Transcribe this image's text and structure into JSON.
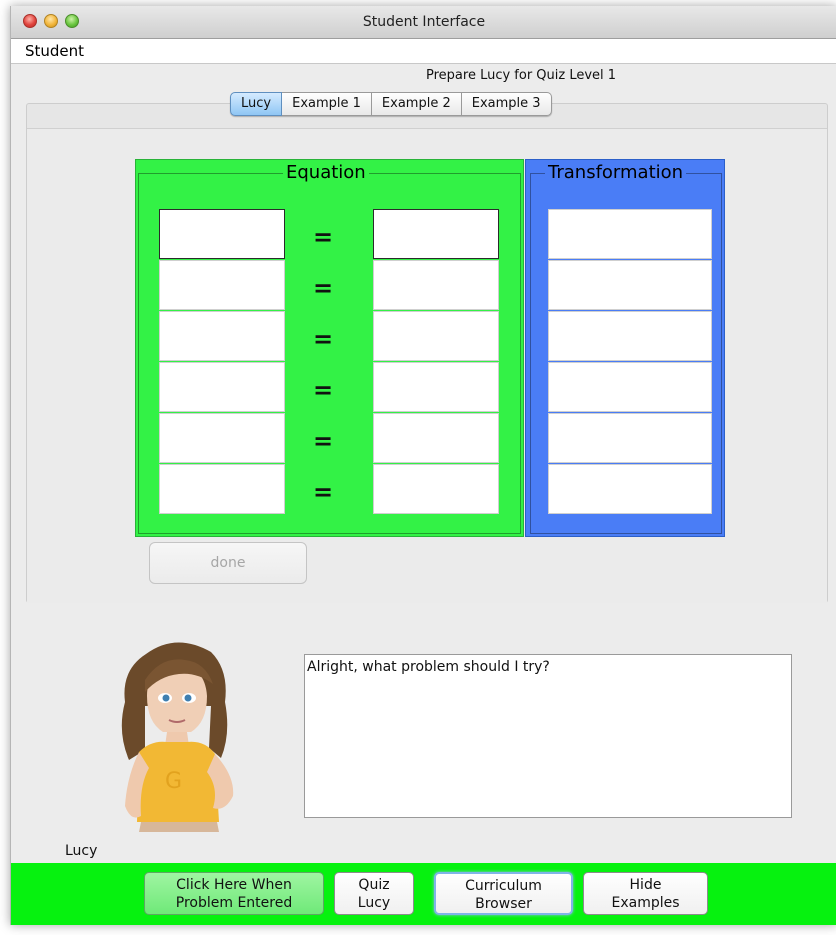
{
  "window": {
    "title": "Student Interface"
  },
  "menu": {
    "items": [
      "Student"
    ]
  },
  "header": {
    "prepare_label": "Prepare Lucy for Quiz Level 1"
  },
  "tabs": [
    {
      "label": "Lucy",
      "active": true
    },
    {
      "label": "Example 1",
      "active": false
    },
    {
      "label": "Example 2",
      "active": false
    },
    {
      "label": "Example 3",
      "active": false
    }
  ],
  "equation": {
    "title": "Equation",
    "equals_sign": "=",
    "rows": [
      {
        "left": "",
        "right": ""
      },
      {
        "left": "",
        "right": ""
      },
      {
        "left": "",
        "right": ""
      },
      {
        "left": "",
        "right": ""
      },
      {
        "left": "",
        "right": ""
      },
      {
        "left": "",
        "right": ""
      }
    ]
  },
  "transformation": {
    "title": "Transformation",
    "rows": [
      "",
      "",
      "",
      "",
      "",
      ""
    ]
  },
  "done_button": {
    "label": "done",
    "enabled": false
  },
  "avatar": {
    "name": "Lucy"
  },
  "speech": {
    "text": "Alright, what problem should I try?"
  },
  "bottom_buttons": [
    {
      "line1": "Click Here When",
      "line2": "Problem Entered"
    },
    {
      "line1": "Quiz",
      "line2": "Lucy"
    },
    {
      "line1": "Curriculum",
      "line2": "Browser"
    },
    {
      "line1": "Hide",
      "line2": "Examples"
    }
  ],
  "colors": {
    "equation_panel": "#33f246",
    "transformation_panel": "#4a7df6",
    "bottom_bar": "#06f20f",
    "active_tab": "#8fc6f4"
  }
}
